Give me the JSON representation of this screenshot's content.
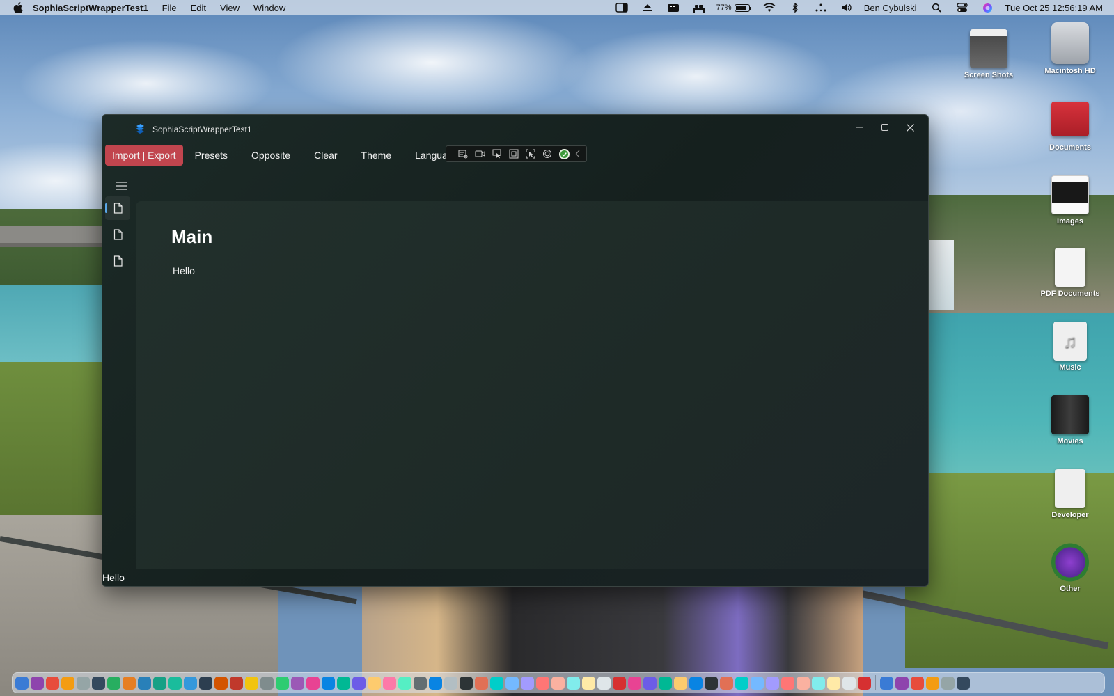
{
  "menubar": {
    "app_name": "SophiaScriptWrapperTest1",
    "menus": [
      "File",
      "Edit",
      "View",
      "Window"
    ],
    "status_icons": [
      "sidebar-icon",
      "eject-icon",
      "media-icon",
      "bed-icon"
    ],
    "battery_percent": "77%",
    "battery_level": 0.77,
    "right_icons": [
      "wifi-icon",
      "bluetooth-icon",
      "network-icon",
      "volume-icon"
    ],
    "user_name": "Ben Cybulski",
    "datetime": "Tue Oct 25  12:56:19 AM"
  },
  "desktop_icons": [
    {
      "label": "Screen Shots",
      "color": "#5a5a5a"
    },
    {
      "label": "Macintosh HD",
      "color": "#b8bcc2"
    },
    {
      "label": "Documents",
      "color": "#c8252f"
    },
    {
      "label": "Images",
      "color": "#1c1c1c"
    },
    {
      "label": "PDF Documents",
      "color": "#eeeeee"
    },
    {
      "label": "Music",
      "color": "#eeeeee"
    },
    {
      "label": "Movies",
      "color": "#2a2a2a"
    },
    {
      "label": "Developer",
      "color": "#eeeeee"
    },
    {
      "label": "Other",
      "color": "#6b3fa8"
    }
  ],
  "window": {
    "title": "SophiaScriptWrapperTest1",
    "menu": {
      "import_export": "Import | Export",
      "presets": "Presets",
      "opposite": "Opposite",
      "clear": "Clear",
      "theme": "Theme",
      "language": "Language",
      "truncated": "A"
    },
    "page_title": "Main",
    "page_text": "Hello",
    "status_text": "Hello",
    "accent": "#c1454e"
  },
  "dock": {
    "colors": [
      "#3a7bd5",
      "#8e44ad",
      "#e74c3c",
      "#f39c12",
      "#95a5a6",
      "#34495e",
      "#27ae60",
      "#e67e22",
      "#2980b9",
      "#16a085",
      "#1abc9c",
      "#3498db",
      "#2c3e50",
      "#d35400",
      "#c0392b",
      "#f1c40f",
      "#7f8c8d",
      "#2ecc71",
      "#9b59b6",
      "#e84393",
      "#0984e3",
      "#00b894",
      "#6c5ce7",
      "#fdcb6e",
      "#fd79a8",
      "#55efc4",
      "#636e72",
      "#0984e3",
      "#b2bec3",
      "#2d3436",
      "#e17055",
      "#00cec9",
      "#74b9ff",
      "#a29bfe",
      "#ff7675",
      "#fab1a0",
      "#81ecec",
      "#ffeaa7",
      "#dfe6e9",
      "#d63031",
      "#e84393",
      "#6c5ce7",
      "#00b894",
      "#fdcb6e",
      "#0984e3",
      "#2d3436",
      "#e17055",
      "#00cec9",
      "#74b9ff",
      "#a29bfe",
      "#ff7675",
      "#fab1a0",
      "#81ecec",
      "#ffeaa7",
      "#dfe6e9",
      "#d63031",
      "#3a7bd5",
      "#8e44ad",
      "#e74c3c",
      "#f39c12",
      "#95a5a6",
      "#34495e"
    ]
  }
}
